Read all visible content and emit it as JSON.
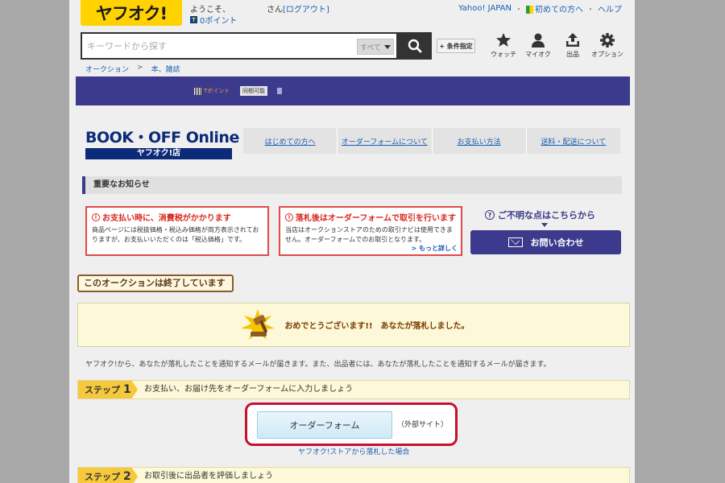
{
  "header": {
    "logo_text": "ヤフオク!",
    "welcome": "ようこそ、",
    "points": "0ポイント",
    "user_suffix": "さん",
    "logout": "[ログアウト]",
    "links": [
      "Yahoo! JAPAN",
      "初めての方へ",
      "ヘルプ"
    ]
  },
  "search": {
    "placeholder": "キーワードから探す",
    "category": "すべて",
    "condition_button": "+ 条件指定"
  },
  "icon_nav": [
    {
      "label": "ウォッチ",
      "icon": "star-icon"
    },
    {
      "label": "マイオク",
      "icon": "user-icon"
    },
    {
      "label": "出品",
      "icon": "upload-icon"
    },
    {
      "label": "オプション",
      "icon": "gear-icon"
    }
  ],
  "breadcrumb": [
    "オークション",
    ">",
    "本、雑誌"
  ],
  "banner": {
    "tag1": "Tポイント",
    "tag2": "同梱可能"
  },
  "store": {
    "logo_top": "BOOK・OFF Online",
    "logo_bottom": "ヤフオク!店",
    "nav": [
      "はじめての方へ",
      "オーダーフォームについて",
      "お支払い方法",
      "送料・配送について"
    ]
  },
  "notice": {
    "title": "重要なお知らせ",
    "box1": {
      "title": "お支払い時に、消費税がかかります",
      "text": "商品ページには税抜価格・税込み価格が両方表示されておりますが、お支払いいただくのは「税込価格」です。"
    },
    "box2": {
      "title": "落札後はオーダーフォームで取引を行います",
      "text": "当店はオークションストアのための取引ナビは使用できません。オーダーフォームでのお取引となります。",
      "more": "> もっと詳しく"
    },
    "help_question": "ご不明な点はこちらから",
    "contact_button": "お問い合わせ"
  },
  "auction": {
    "ended": "このオークションは終了しています",
    "congrats": "おめでとうございます!!　あなたが落札しました。",
    "info": "ヤフオク!から、あなたが落札したことを通知するメールが届きます。また、出品者には、あなたが落札したことを通知するメールが届きます。"
  },
  "steps": [
    {
      "label": "ステップ",
      "num": "1",
      "text": "お支払い、お届け先をオーダーフォームに入力しましょう"
    },
    {
      "label": "ステップ",
      "num": "2",
      "text": "お取引後に出品者を評価しましょう"
    }
  ],
  "order_form": {
    "button": "オーダーフォーム",
    "external": "（外部サイト）",
    "store_link": "ヤフオク!ストアから落札した場合"
  }
}
